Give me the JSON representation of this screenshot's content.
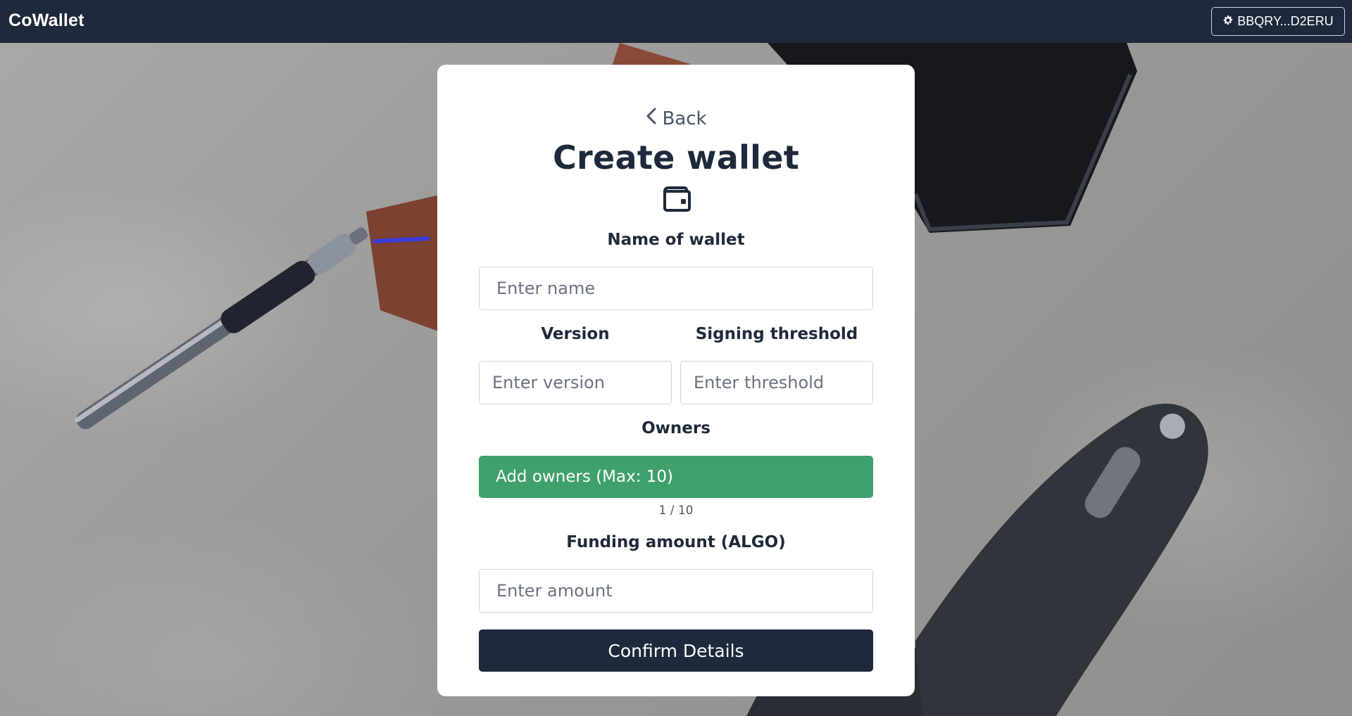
{
  "app": {
    "brand": "CoWallet",
    "account_label": "BBQRY...D2ERU",
    "account_icon": "gear-icon"
  },
  "form": {
    "back_label": "Back",
    "title": "Create wallet",
    "title_icon": "wallet-icon",
    "name_label": "Name of wallet",
    "name_placeholder": "Enter name",
    "name_value": "",
    "version_label": "Version",
    "version_placeholder": "Enter version",
    "version_value": "",
    "threshold_label": "Signing threshold",
    "threshold_placeholder": "Enter threshold",
    "threshold_value": "",
    "owners_label": "Owners",
    "add_owners_label": "Add owners (Max: 10)",
    "owners_count": "1 / 10",
    "funding_label": "Funding amount (ALGO)",
    "funding_placeholder": "Enter amount",
    "funding_value": "",
    "confirm_label": "Confirm Details"
  },
  "colors": {
    "navbar": "#1e293b",
    "primary_dark": "#1e293b",
    "accent_green": "#3fa06b",
    "card": "#ffffff"
  }
}
